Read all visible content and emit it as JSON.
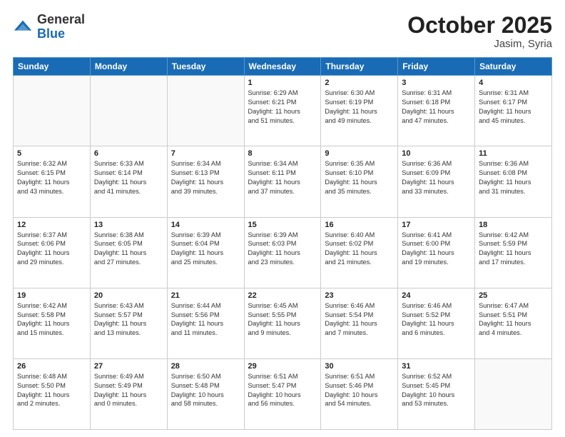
{
  "header": {
    "logo_general": "General",
    "logo_blue": "Blue",
    "month": "October 2025",
    "location": "Jasim, Syria"
  },
  "weekdays": [
    "Sunday",
    "Monday",
    "Tuesday",
    "Wednesday",
    "Thursday",
    "Friday",
    "Saturday"
  ],
  "weeks": [
    [
      {
        "day": "",
        "content": ""
      },
      {
        "day": "",
        "content": ""
      },
      {
        "day": "",
        "content": ""
      },
      {
        "day": "1",
        "content": "Sunrise: 6:29 AM\nSunset: 6:21 PM\nDaylight: 11 hours\nand 51 minutes."
      },
      {
        "day": "2",
        "content": "Sunrise: 6:30 AM\nSunset: 6:19 PM\nDaylight: 11 hours\nand 49 minutes."
      },
      {
        "day": "3",
        "content": "Sunrise: 6:31 AM\nSunset: 6:18 PM\nDaylight: 11 hours\nand 47 minutes."
      },
      {
        "day": "4",
        "content": "Sunrise: 6:31 AM\nSunset: 6:17 PM\nDaylight: 11 hours\nand 45 minutes."
      }
    ],
    [
      {
        "day": "5",
        "content": "Sunrise: 6:32 AM\nSunset: 6:15 PM\nDaylight: 11 hours\nand 43 minutes."
      },
      {
        "day": "6",
        "content": "Sunrise: 6:33 AM\nSunset: 6:14 PM\nDaylight: 11 hours\nand 41 minutes."
      },
      {
        "day": "7",
        "content": "Sunrise: 6:34 AM\nSunset: 6:13 PM\nDaylight: 11 hours\nand 39 minutes."
      },
      {
        "day": "8",
        "content": "Sunrise: 6:34 AM\nSunset: 6:11 PM\nDaylight: 11 hours\nand 37 minutes."
      },
      {
        "day": "9",
        "content": "Sunrise: 6:35 AM\nSunset: 6:10 PM\nDaylight: 11 hours\nand 35 minutes."
      },
      {
        "day": "10",
        "content": "Sunrise: 6:36 AM\nSunset: 6:09 PM\nDaylight: 11 hours\nand 33 minutes."
      },
      {
        "day": "11",
        "content": "Sunrise: 6:36 AM\nSunset: 6:08 PM\nDaylight: 11 hours\nand 31 minutes."
      }
    ],
    [
      {
        "day": "12",
        "content": "Sunrise: 6:37 AM\nSunset: 6:06 PM\nDaylight: 11 hours\nand 29 minutes."
      },
      {
        "day": "13",
        "content": "Sunrise: 6:38 AM\nSunset: 6:05 PM\nDaylight: 11 hours\nand 27 minutes."
      },
      {
        "day": "14",
        "content": "Sunrise: 6:39 AM\nSunset: 6:04 PM\nDaylight: 11 hours\nand 25 minutes."
      },
      {
        "day": "15",
        "content": "Sunrise: 6:39 AM\nSunset: 6:03 PM\nDaylight: 11 hours\nand 23 minutes."
      },
      {
        "day": "16",
        "content": "Sunrise: 6:40 AM\nSunset: 6:02 PM\nDaylight: 11 hours\nand 21 minutes."
      },
      {
        "day": "17",
        "content": "Sunrise: 6:41 AM\nSunset: 6:00 PM\nDaylight: 11 hours\nand 19 minutes."
      },
      {
        "day": "18",
        "content": "Sunrise: 6:42 AM\nSunset: 5:59 PM\nDaylight: 11 hours\nand 17 minutes."
      }
    ],
    [
      {
        "day": "19",
        "content": "Sunrise: 6:42 AM\nSunset: 5:58 PM\nDaylight: 11 hours\nand 15 minutes."
      },
      {
        "day": "20",
        "content": "Sunrise: 6:43 AM\nSunset: 5:57 PM\nDaylight: 11 hours\nand 13 minutes."
      },
      {
        "day": "21",
        "content": "Sunrise: 6:44 AM\nSunset: 5:56 PM\nDaylight: 11 hours\nand 11 minutes."
      },
      {
        "day": "22",
        "content": "Sunrise: 6:45 AM\nSunset: 5:55 PM\nDaylight: 11 hours\nand 9 minutes."
      },
      {
        "day": "23",
        "content": "Sunrise: 6:46 AM\nSunset: 5:54 PM\nDaylight: 11 hours\nand 7 minutes."
      },
      {
        "day": "24",
        "content": "Sunrise: 6:46 AM\nSunset: 5:52 PM\nDaylight: 11 hours\nand 6 minutes."
      },
      {
        "day": "25",
        "content": "Sunrise: 6:47 AM\nSunset: 5:51 PM\nDaylight: 11 hours\nand 4 minutes."
      }
    ],
    [
      {
        "day": "26",
        "content": "Sunrise: 6:48 AM\nSunset: 5:50 PM\nDaylight: 11 hours\nand 2 minutes."
      },
      {
        "day": "27",
        "content": "Sunrise: 6:49 AM\nSunset: 5:49 PM\nDaylight: 11 hours\nand 0 minutes."
      },
      {
        "day": "28",
        "content": "Sunrise: 6:50 AM\nSunset: 5:48 PM\nDaylight: 10 hours\nand 58 minutes."
      },
      {
        "day": "29",
        "content": "Sunrise: 6:51 AM\nSunset: 5:47 PM\nDaylight: 10 hours\nand 56 minutes."
      },
      {
        "day": "30",
        "content": "Sunrise: 6:51 AM\nSunset: 5:46 PM\nDaylight: 10 hours\nand 54 minutes."
      },
      {
        "day": "31",
        "content": "Sunrise: 6:52 AM\nSunset: 5:45 PM\nDaylight: 10 hours\nand 53 minutes."
      },
      {
        "day": "",
        "content": ""
      }
    ]
  ]
}
